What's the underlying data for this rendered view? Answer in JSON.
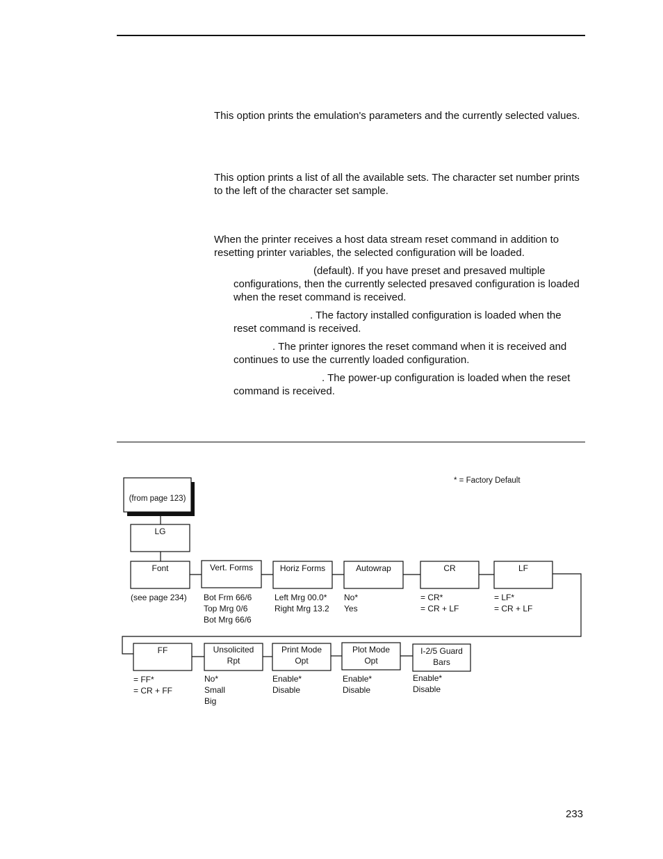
{
  "page": {
    "number": "233"
  },
  "body": {
    "print_emulation_desc": "This option prints the emulation's parameters and the currently selected values.",
    "char_sets_desc": "This option prints a list of all the available sets. The character set number prints to the left of the character set sample.",
    "reset_cmd_desc": "When the printer receives a host data stream reset command in addition to resetting printer variables, the selected configuration will be loaded.",
    "options": [
      {
        "text": "(default). If you have preset and presaved multiple configurations, then the currently selected presaved configuration is loaded when the reset command is received."
      },
      {
        "text": ". The factory installed configuration is loaded when the reset command is received."
      },
      {
        "text": ". The printer ignores the reset command when it is received and continues to use the currently loaded configuration."
      },
      {
        "text": ". The power-up configuration is loaded when the reset command is received."
      }
    ]
  },
  "diagram": {
    "legend": "* = Factory Default",
    "entry_box": "(from page 123)",
    "root_box": "LG",
    "row1": [
      {
        "label": "Font",
        "options": [
          "(see page 234)"
        ]
      },
      {
        "label": "Vert. Forms",
        "options": [
          "Bot Frm 66/6",
          "Top Mrg 0/6",
          "Bot Mrg 66/6"
        ]
      },
      {
        "label": "Horiz Forms",
        "options": [
          "Left Mrg 00.0*",
          "Right Mrg 13.2"
        ]
      },
      {
        "label": "Autowrap",
        "options": [
          "No*",
          "Yes"
        ]
      },
      {
        "label": "CR",
        "options": [
          "= CR*",
          "= CR + LF"
        ]
      },
      {
        "label": "LF",
        "options": [
          "= LF*",
          "= CR + LF"
        ]
      }
    ],
    "row2": [
      {
        "label": "FF",
        "options": [
          "= FF*",
          "= CR + FF"
        ]
      },
      {
        "label": "Unsolicited Rpt",
        "label_lines": [
          "Unsolicited",
          "Rpt"
        ],
        "options": [
          "No*",
          "Small",
          "Big"
        ]
      },
      {
        "label": "Print Mode Opt",
        "label_lines": [
          "Print Mode",
          "Opt"
        ],
        "options": [
          "Enable*",
          "Disable"
        ]
      },
      {
        "label": "Plot Mode Opt",
        "label_lines": [
          "Plot Mode",
          "Opt"
        ],
        "options": [
          "Enable*",
          "Disable"
        ]
      },
      {
        "label": "I-2/5 Guard Bars",
        "label_lines": [
          "I-2/5 Guard",
          "Bars"
        ],
        "options": [
          "Enable*",
          "Disable"
        ]
      }
    ]
  }
}
